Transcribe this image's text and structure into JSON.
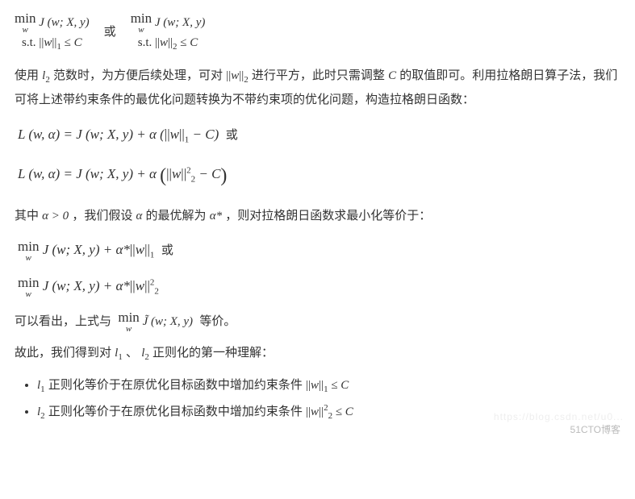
{
  "top": {
    "left_line1": "min J (w; X, y)",
    "left_sub": "w",
    "left_line2": "s.t. ||w||₁ ≤ C",
    "mid": "或",
    "right_line1": "min J (w; X, y)",
    "right_sub": "w",
    "right_line2": "s.t. ||w||₂ ≤ C"
  },
  "p1": "使用 l₂ 范数时，为方便后续处理，可对 ||w||₂ 进行平方，此时只需调整 C 的取值即可。利用拉格朗日算子法，我们可将上述带约束条件的最优化问题转换为不带约束项的优化问题，构造拉格朗日函数：",
  "lag1_pre": "L (w, α) = J (w; X, y) + α (||w||₁ − C)",
  "or": "或",
  "lag2": "L (w, α) = J (w; X, y) + α ( ||w||₂² − C )",
  "p2_a": "其中 α > 0 ，我们假设 α 的最优解为 α* ，则对拉格朗日函数求最小化等价于：",
  "min1": "min J (w; X, y) + α*||w||₁",
  "min2": "min J (w; X, y) + α*||w||₂²",
  "p3_a": "可以看出，上式与",
  "p3_b": "min J̃ (w; X, y)",
  "p3_c": "等价。",
  "p4": "故此，我们得到对 l₁ 、 l₂ 正则化的第一种理解：",
  "li1": "l₁ 正则化等价于在原优化目标函数中增加约束条件 ||w||₁ ≤ C",
  "li2": "l₂ 正则化等价于在原优化目标函数中增加约束条件 ||w||₂² ≤ C",
  "watermark": "51CTO博客",
  "wm2": "https://blog.csdn.net/u0..."
}
